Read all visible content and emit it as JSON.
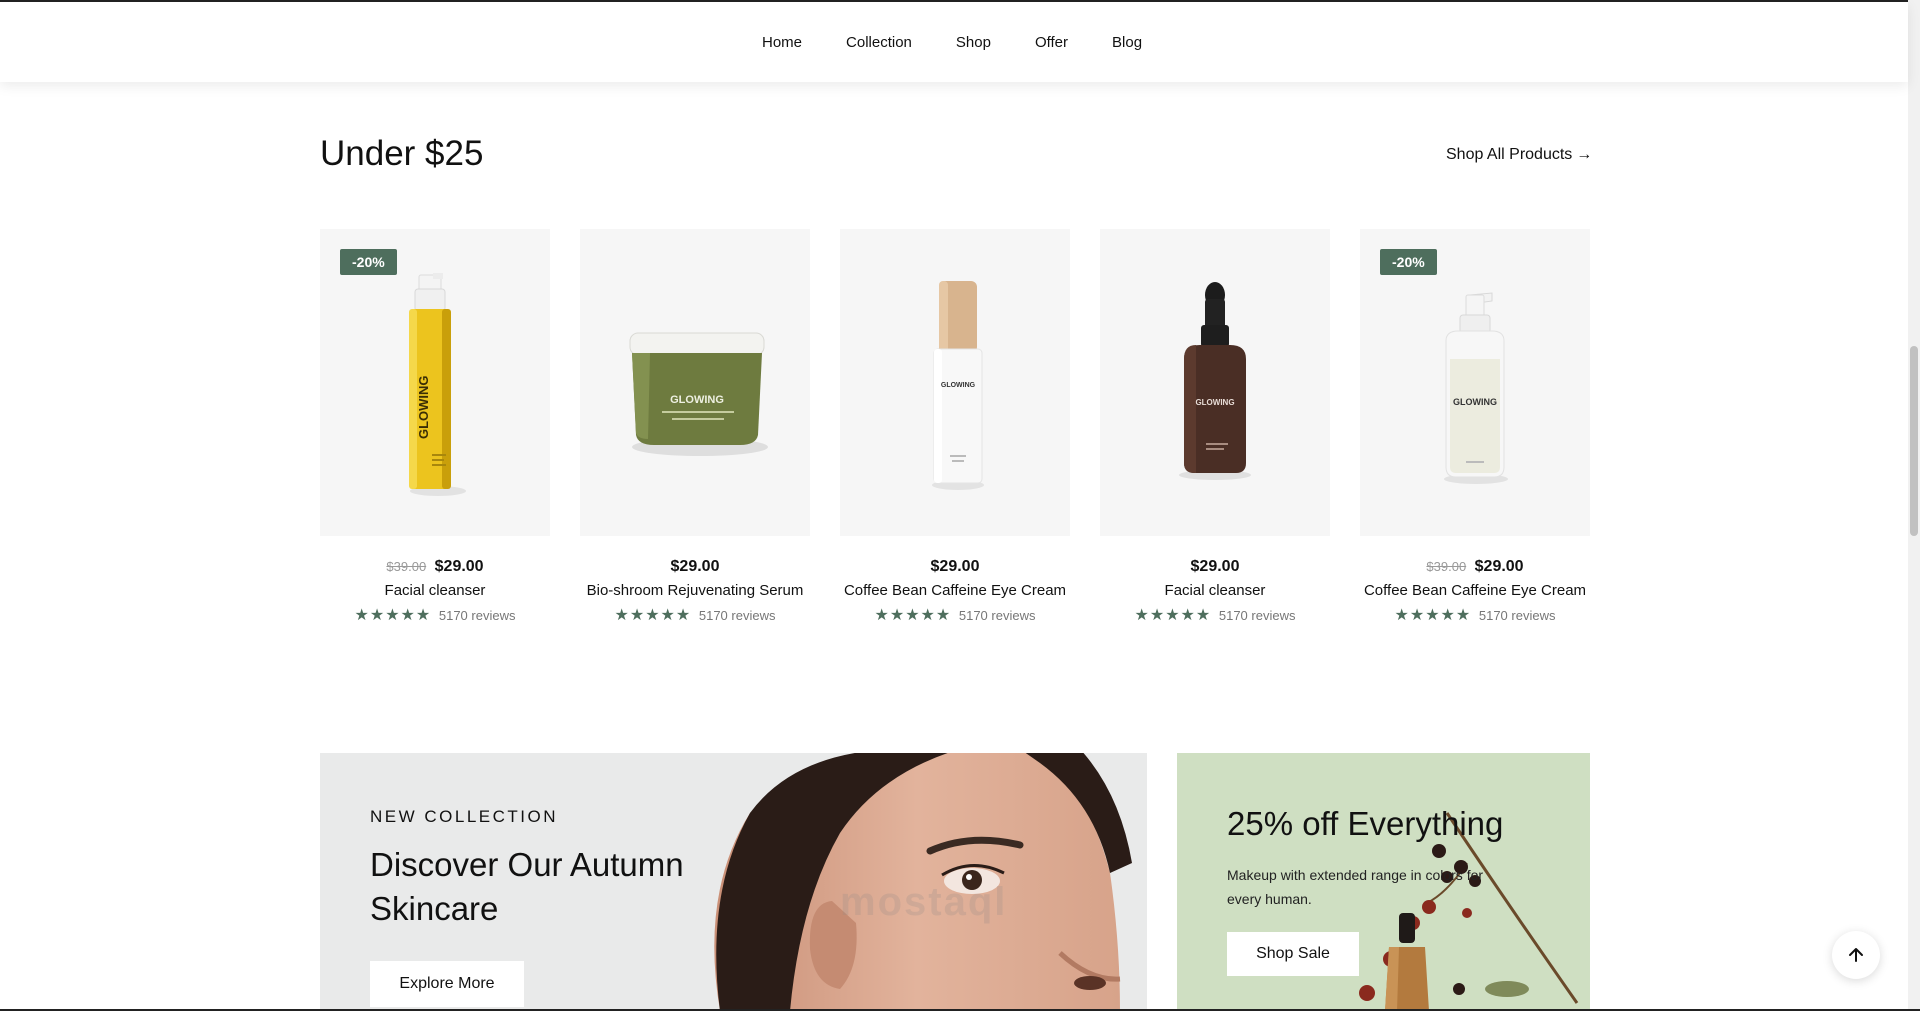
{
  "nav": {
    "items": [
      {
        "label": "Home"
      },
      {
        "label": "Collection"
      },
      {
        "label": "Shop"
      },
      {
        "label": "Offer"
      },
      {
        "label": "Blog"
      }
    ]
  },
  "section": {
    "title": "Under $25",
    "shop_all_label": "Shop All Products",
    "shop_all_arrow": "→"
  },
  "products": [
    {
      "badge": "-20%",
      "old_price": "$39.00",
      "price": "$29.00",
      "name": "Facial cleanser",
      "stars": "★★★★★",
      "reviews": "5170 reviews",
      "brand": "GLOWING"
    },
    {
      "price": "$29.00",
      "name": "Bio-shroom Rejuvenating Serum",
      "stars": "★★★★★",
      "reviews": "5170 reviews",
      "brand": "GLOWING"
    },
    {
      "price": "$29.00",
      "name": "Coffee Bean Caffeine Eye Cream",
      "stars": "★★★★★",
      "reviews": "5170 reviews",
      "brand": "GLOWING"
    },
    {
      "price": "$29.00",
      "name": "Facial cleanser",
      "stars": "★★★★★",
      "reviews": "5170 reviews",
      "brand": "GLOWING"
    },
    {
      "badge": "-20%",
      "old_price": "$39.00",
      "price": "$29.00",
      "name": "Coffee Bean Caffeine Eye Cream",
      "stars": "★★★★★",
      "reviews": "5170 reviews",
      "brand": "GLOWING"
    }
  ],
  "banner_collection": {
    "eyebrow": "NEW COLLECTION",
    "heading": "Discover Our Autumn Skincare",
    "button": "Explore More"
  },
  "banner_sale": {
    "heading": "25% off Everything",
    "description": "Makeup with extended range in colors for every human.",
    "button": "Shop Sale"
  },
  "watermark": "mostaql",
  "icons": {
    "scroll_top": "arrow-up-icon",
    "star": "star-icon"
  },
  "colors": {
    "accent": "#4e6e5d",
    "product_bg": "#f6f6f6",
    "sale_banner_bg": "#cfdfc2"
  }
}
